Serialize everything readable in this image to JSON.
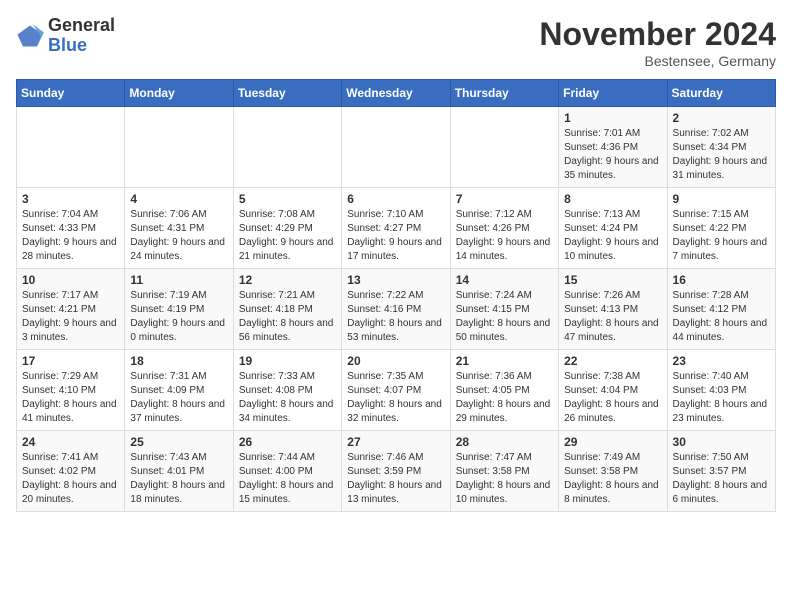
{
  "header": {
    "logo_line1": "General",
    "logo_line2": "Blue",
    "month_title": "November 2024",
    "location": "Bestensee, Germany"
  },
  "days_of_week": [
    "Sunday",
    "Monday",
    "Tuesday",
    "Wednesday",
    "Thursday",
    "Friday",
    "Saturday"
  ],
  "weeks": [
    [
      {
        "day": "",
        "info": ""
      },
      {
        "day": "",
        "info": ""
      },
      {
        "day": "",
        "info": ""
      },
      {
        "day": "",
        "info": ""
      },
      {
        "day": "",
        "info": ""
      },
      {
        "day": "1",
        "info": "Sunrise: 7:01 AM\nSunset: 4:36 PM\nDaylight: 9 hours and 35 minutes."
      },
      {
        "day": "2",
        "info": "Sunrise: 7:02 AM\nSunset: 4:34 PM\nDaylight: 9 hours and 31 minutes."
      }
    ],
    [
      {
        "day": "3",
        "info": "Sunrise: 7:04 AM\nSunset: 4:33 PM\nDaylight: 9 hours and 28 minutes."
      },
      {
        "day": "4",
        "info": "Sunrise: 7:06 AM\nSunset: 4:31 PM\nDaylight: 9 hours and 24 minutes."
      },
      {
        "day": "5",
        "info": "Sunrise: 7:08 AM\nSunset: 4:29 PM\nDaylight: 9 hours and 21 minutes."
      },
      {
        "day": "6",
        "info": "Sunrise: 7:10 AM\nSunset: 4:27 PM\nDaylight: 9 hours and 17 minutes."
      },
      {
        "day": "7",
        "info": "Sunrise: 7:12 AM\nSunset: 4:26 PM\nDaylight: 9 hours and 14 minutes."
      },
      {
        "day": "8",
        "info": "Sunrise: 7:13 AM\nSunset: 4:24 PM\nDaylight: 9 hours and 10 minutes."
      },
      {
        "day": "9",
        "info": "Sunrise: 7:15 AM\nSunset: 4:22 PM\nDaylight: 9 hours and 7 minutes."
      }
    ],
    [
      {
        "day": "10",
        "info": "Sunrise: 7:17 AM\nSunset: 4:21 PM\nDaylight: 9 hours and 3 minutes."
      },
      {
        "day": "11",
        "info": "Sunrise: 7:19 AM\nSunset: 4:19 PM\nDaylight: 9 hours and 0 minutes."
      },
      {
        "day": "12",
        "info": "Sunrise: 7:21 AM\nSunset: 4:18 PM\nDaylight: 8 hours and 56 minutes."
      },
      {
        "day": "13",
        "info": "Sunrise: 7:22 AM\nSunset: 4:16 PM\nDaylight: 8 hours and 53 minutes."
      },
      {
        "day": "14",
        "info": "Sunrise: 7:24 AM\nSunset: 4:15 PM\nDaylight: 8 hours and 50 minutes."
      },
      {
        "day": "15",
        "info": "Sunrise: 7:26 AM\nSunset: 4:13 PM\nDaylight: 8 hours and 47 minutes."
      },
      {
        "day": "16",
        "info": "Sunrise: 7:28 AM\nSunset: 4:12 PM\nDaylight: 8 hours and 44 minutes."
      }
    ],
    [
      {
        "day": "17",
        "info": "Sunrise: 7:29 AM\nSunset: 4:10 PM\nDaylight: 8 hours and 41 minutes."
      },
      {
        "day": "18",
        "info": "Sunrise: 7:31 AM\nSunset: 4:09 PM\nDaylight: 8 hours and 37 minutes."
      },
      {
        "day": "19",
        "info": "Sunrise: 7:33 AM\nSunset: 4:08 PM\nDaylight: 8 hours and 34 minutes."
      },
      {
        "day": "20",
        "info": "Sunrise: 7:35 AM\nSunset: 4:07 PM\nDaylight: 8 hours and 32 minutes."
      },
      {
        "day": "21",
        "info": "Sunrise: 7:36 AM\nSunset: 4:05 PM\nDaylight: 8 hours and 29 minutes."
      },
      {
        "day": "22",
        "info": "Sunrise: 7:38 AM\nSunset: 4:04 PM\nDaylight: 8 hours and 26 minutes."
      },
      {
        "day": "23",
        "info": "Sunrise: 7:40 AM\nSunset: 4:03 PM\nDaylight: 8 hours and 23 minutes."
      }
    ],
    [
      {
        "day": "24",
        "info": "Sunrise: 7:41 AM\nSunset: 4:02 PM\nDaylight: 8 hours and 20 minutes."
      },
      {
        "day": "25",
        "info": "Sunrise: 7:43 AM\nSunset: 4:01 PM\nDaylight: 8 hours and 18 minutes."
      },
      {
        "day": "26",
        "info": "Sunrise: 7:44 AM\nSunset: 4:00 PM\nDaylight: 8 hours and 15 minutes."
      },
      {
        "day": "27",
        "info": "Sunrise: 7:46 AM\nSunset: 3:59 PM\nDaylight: 8 hours and 13 minutes."
      },
      {
        "day": "28",
        "info": "Sunrise: 7:47 AM\nSunset: 3:58 PM\nDaylight: 8 hours and 10 minutes."
      },
      {
        "day": "29",
        "info": "Sunrise: 7:49 AM\nSunset: 3:58 PM\nDaylight: 8 hours and 8 minutes."
      },
      {
        "day": "30",
        "info": "Sunrise: 7:50 AM\nSunset: 3:57 PM\nDaylight: 8 hours and 6 minutes."
      }
    ]
  ]
}
